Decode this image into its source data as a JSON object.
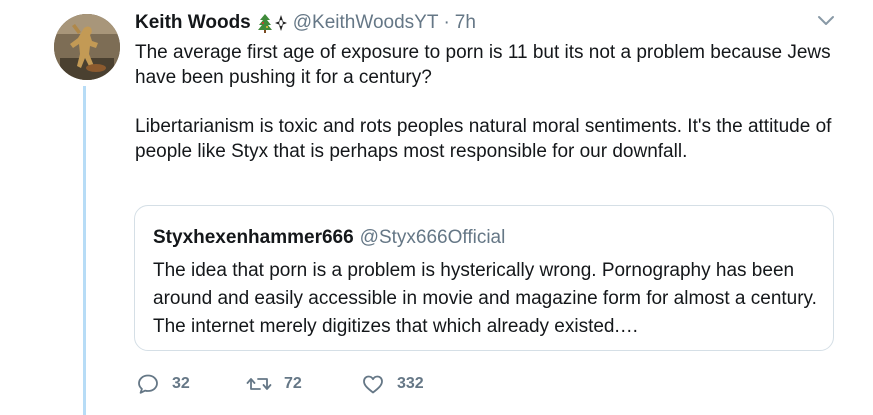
{
  "tweet": {
    "author_name": "Keith Woods",
    "emoji_icons": [
      "christmas-tree-icon",
      "compass-rose-icon"
    ],
    "handle": "@KeithWoodsYT",
    "separator": "·",
    "time": "7h",
    "paragraphs": [
      "The average first age of exposure to porn is 11 but its not a problem because Jews have been pushing it for a century?",
      "Libertarianism is toxic and rots peoples natural moral sentiments. It's the attitude of people like Styx that is perhaps most responsible for our downfall."
    ]
  },
  "quoted_tweet": {
    "author_name": "Styxhexenhammer666",
    "handle": "@Styx666Official",
    "text": "The idea that porn is a problem is hysterically wrong. Pornography has been around and easily accessible in movie and magazine form for almost a century. The internet merely digitizes that which already existed.…"
  },
  "actions": {
    "replies": "32",
    "retweets": "72",
    "likes": "332"
  },
  "colors": {
    "text": "#14171a",
    "muted": "#657786",
    "thread_line": "#b7dcf6",
    "border": "#d5dfe6"
  }
}
